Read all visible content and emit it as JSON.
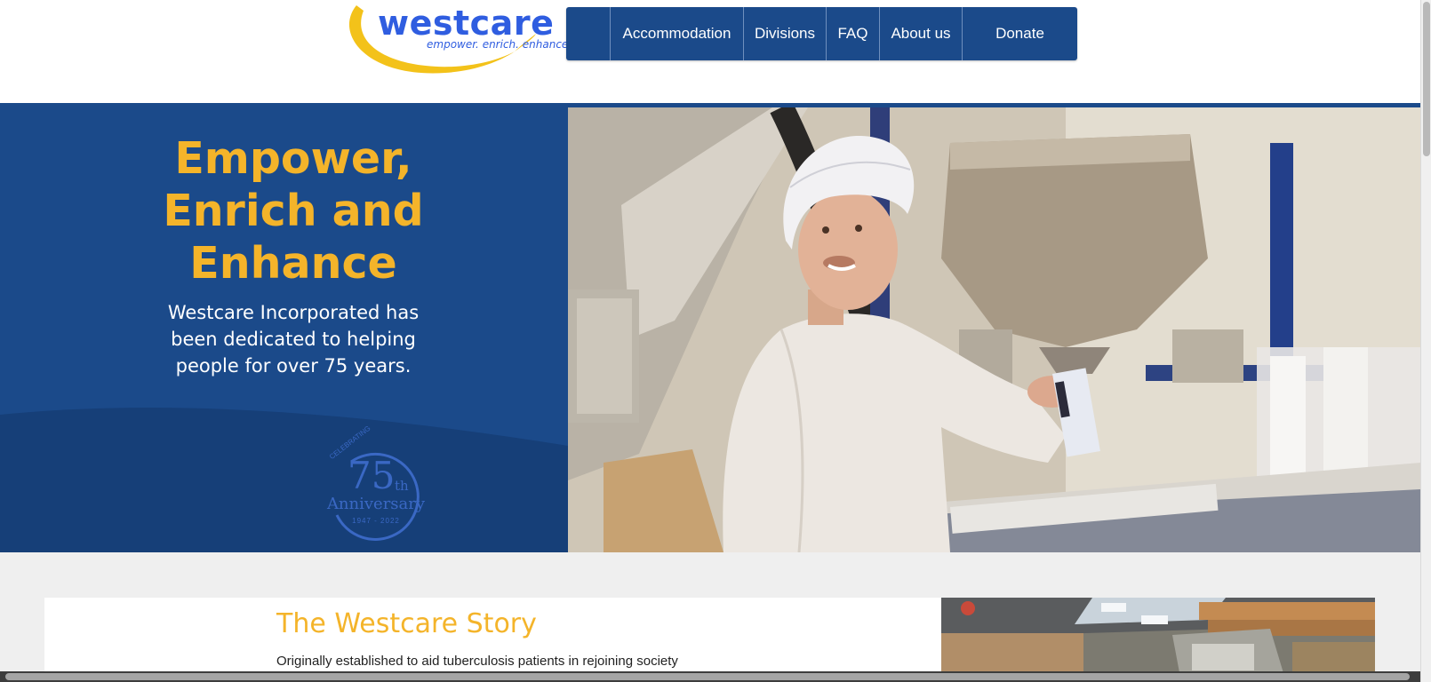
{
  "logo": {
    "wordmark": "westcare",
    "tagline": "empower. enrich. enhance."
  },
  "nav": {
    "items": [
      {
        "label": ""
      },
      {
        "label": "Accommodation"
      },
      {
        "label": "Divisions"
      },
      {
        "label": "FAQ"
      },
      {
        "label": "About us"
      },
      {
        "label": "Donate"
      }
    ]
  },
  "hero": {
    "title_lines": [
      "Empower,",
      "Enrich and",
      "Enhance"
    ],
    "subtitle_lines": [
      "Westcare Incorporated has",
      "been dedicated to helping",
      "people for over 75 years."
    ],
    "badge": {
      "celebrating": "CELEBRATING",
      "number": "75",
      "suffix": "th",
      "word": "Anniversary",
      "years": "1947 - 2022"
    }
  },
  "story": {
    "title": "The Westcare Story",
    "text": "Originally established to aid tuberculosis patients in rejoining society"
  },
  "colors": {
    "brand_blue": "#1b4a8a",
    "accent_yellow": "#f4b42a",
    "logo_blue": "#2f5de0"
  }
}
